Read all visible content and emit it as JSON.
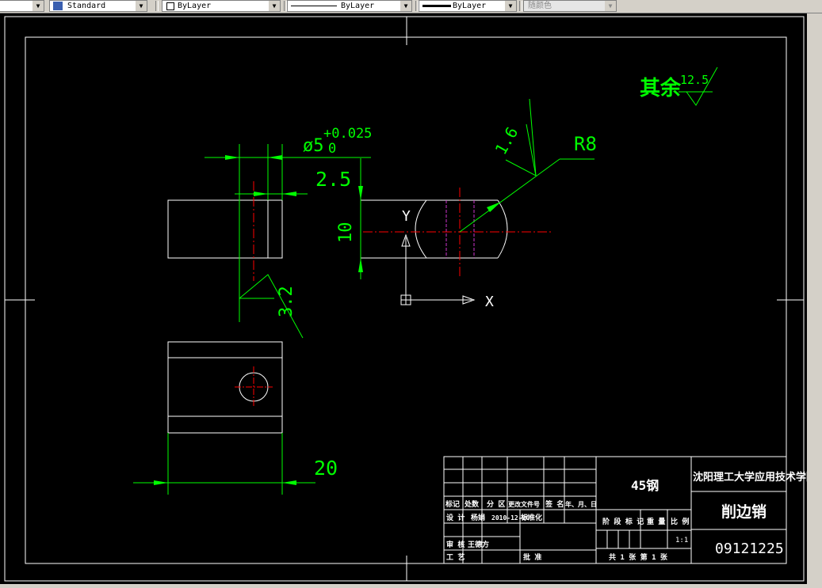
{
  "toolbar": {
    "dimstyle": "Standard",
    "layer": "ByLayer",
    "linetype": "ByLayer",
    "lineweight": "ByLayer",
    "color": "随颜色"
  },
  "drawing": {
    "roughness_note": "其余",
    "roughness_note_value": "12.5",
    "dim_diameter": "ø5",
    "tol_upper": "+0.025",
    "tol_lower": "0",
    "dim_offset": "2.5",
    "dim_height": "10",
    "roughness_left": "3.2",
    "roughness_right": "1.6",
    "dim_radius": "R8",
    "dim_width": "20",
    "ucs_y": "Y",
    "ucs_x": "X"
  },
  "title_block": {
    "material": "45钢",
    "school": "沈阳理工大学应用技术学院",
    "part_name": "削边销",
    "drawing_no": "09121225",
    "scale": "1:1",
    "hdr_mark": "标记",
    "hdr_count": "处数",
    "hdr_zone": "分 区",
    "hdr_doc": "更改文件号",
    "hdr_sign": "签 名",
    "hdr_date": "年、月、日",
    "design": "设 计",
    "designer": "杨娟",
    "date": "2010-12-20",
    "standardize": "标准化",
    "stage": "阶 段 标 记",
    "weight": "重 量",
    "ratio": "比 例",
    "review": "审 核",
    "reviewer": "王德方",
    "process": "工 艺",
    "approve": "批 准",
    "sheets": "共 1   张   第   1 张"
  }
}
